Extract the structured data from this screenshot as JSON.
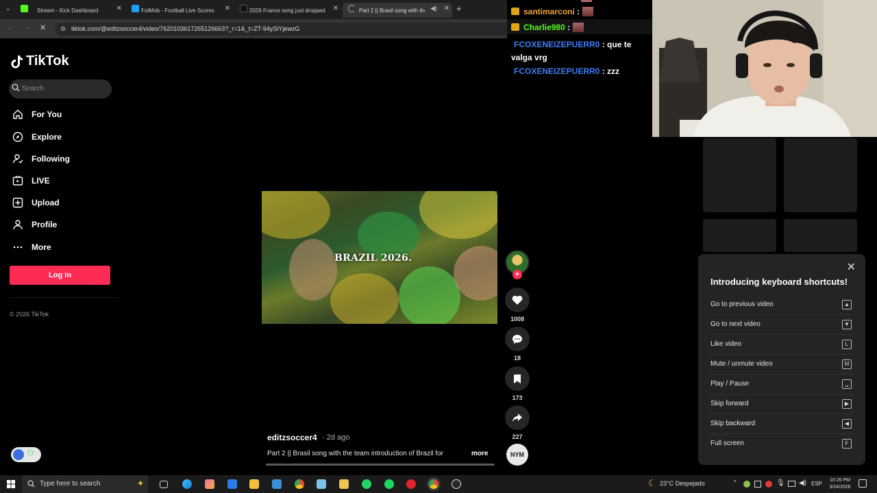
{
  "browser": {
    "tabs": [
      {
        "label": "Stream - Kick Dashboard",
        "color": "#53fc18"
      },
      {
        "label": "FotMob - Football Live Scores",
        "color": "#1ca3f7"
      },
      {
        "label": "2026 France song just dropped",
        "color": "#111111"
      },
      {
        "label": "Part 2 || Brasil song with the",
        "color": "#777777"
      }
    ],
    "url": "tiktok.com/@editzsoccer4/video/7620103617265126663?_r=1&_t=ZT-94ySiYjewzG"
  },
  "tiktok": {
    "brand": "TikTok",
    "search_placeholder": "Search",
    "nav": [
      {
        "label": "For You",
        "icon": "home-icon"
      },
      {
        "label": "Explore",
        "icon": "compass-icon"
      },
      {
        "label": "Following",
        "icon": "following-icon"
      },
      {
        "label": "LIVE",
        "icon": "live-icon"
      },
      {
        "label": "Upload",
        "icon": "upload-icon"
      },
      {
        "label": "Profile",
        "icon": "profile-icon"
      },
      {
        "label": "More",
        "icon": "more-icon"
      }
    ],
    "login_label": "Log in",
    "login_color": "#fe2c55",
    "copyright": "© 2026 TikTok"
  },
  "video": {
    "overlay_title": "BRAZIL 2026.",
    "author": "editzsoccer4",
    "age": "· 2d ago",
    "description": "Part 2 ||  Brasil song with the team introduction of Brazil for",
    "more_label": "more",
    "likes": "1008",
    "comments": "18",
    "saves": "173",
    "shares": "227",
    "music_label": "NYM"
  },
  "chat": [
    {
      "user": "santimarconi",
      "color": "#f0a43a",
      "text": ":"
    },
    {
      "user": "Charlie980",
      "color": "#53fc18",
      "text": ":"
    },
    {
      "user": "FCOXENEIZEPUERR0",
      "color": "#3d7cf0",
      "text": ": que te valga vrg"
    },
    {
      "user": "FCOXENEIZEPUERR0",
      "color": "#3d7cf0",
      "text": ": zzz"
    }
  ],
  "shortcuts": {
    "title": "Introducing keyboard shortcuts!",
    "rows": [
      {
        "label": "Go to previous video",
        "key": "▲"
      },
      {
        "label": "Go to next video",
        "key": "▼"
      },
      {
        "label": "Like video",
        "key": "L"
      },
      {
        "label": "Mute / unmute video",
        "key": "M"
      },
      {
        "label": "Play / Pause",
        "key": "␣"
      },
      {
        "label": "Skip forward",
        "key": "▶"
      },
      {
        "label": "Skip backward",
        "key": "◀"
      },
      {
        "label": "Full screen",
        "key": "F"
      }
    ]
  },
  "taskbar": {
    "search_placeholder": "Type here to search",
    "weather": "23°C  Despejado",
    "language": "ESP",
    "time": "10:26 PM",
    "date": "3/24/2026"
  }
}
